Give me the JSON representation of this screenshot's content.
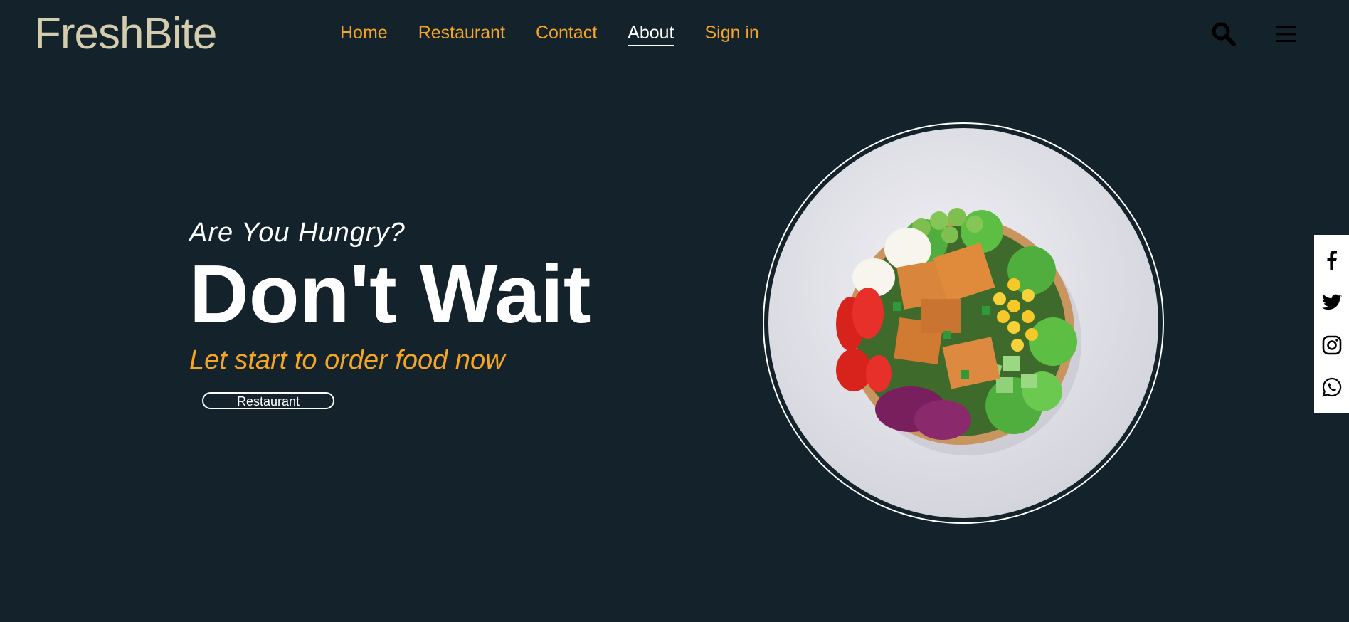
{
  "brand": {
    "name": "FreshBite"
  },
  "nav": {
    "items": [
      {
        "label": "Home"
      },
      {
        "label": "Restaurant"
      },
      {
        "label": "Contact"
      },
      {
        "label": "About",
        "active": true
      },
      {
        "label": "Sign in"
      }
    ]
  },
  "header_icons": [
    "search-icon",
    "hamburger-menu-icon"
  ],
  "hero": {
    "subtitle": "Are You Hungry?",
    "headline": "Don't Wait",
    "tagline": "Let start to order food now",
    "cta_label": "Restaurant",
    "image": "salad-bowl"
  },
  "social": [
    "facebook-icon",
    "twitter-icon",
    "instagram-icon",
    "whatsapp-icon"
  ],
  "colors": {
    "background": "#14222c",
    "accent": "#f5a623",
    "logo": "#d3cdae",
    "text": "#ffffff"
  }
}
